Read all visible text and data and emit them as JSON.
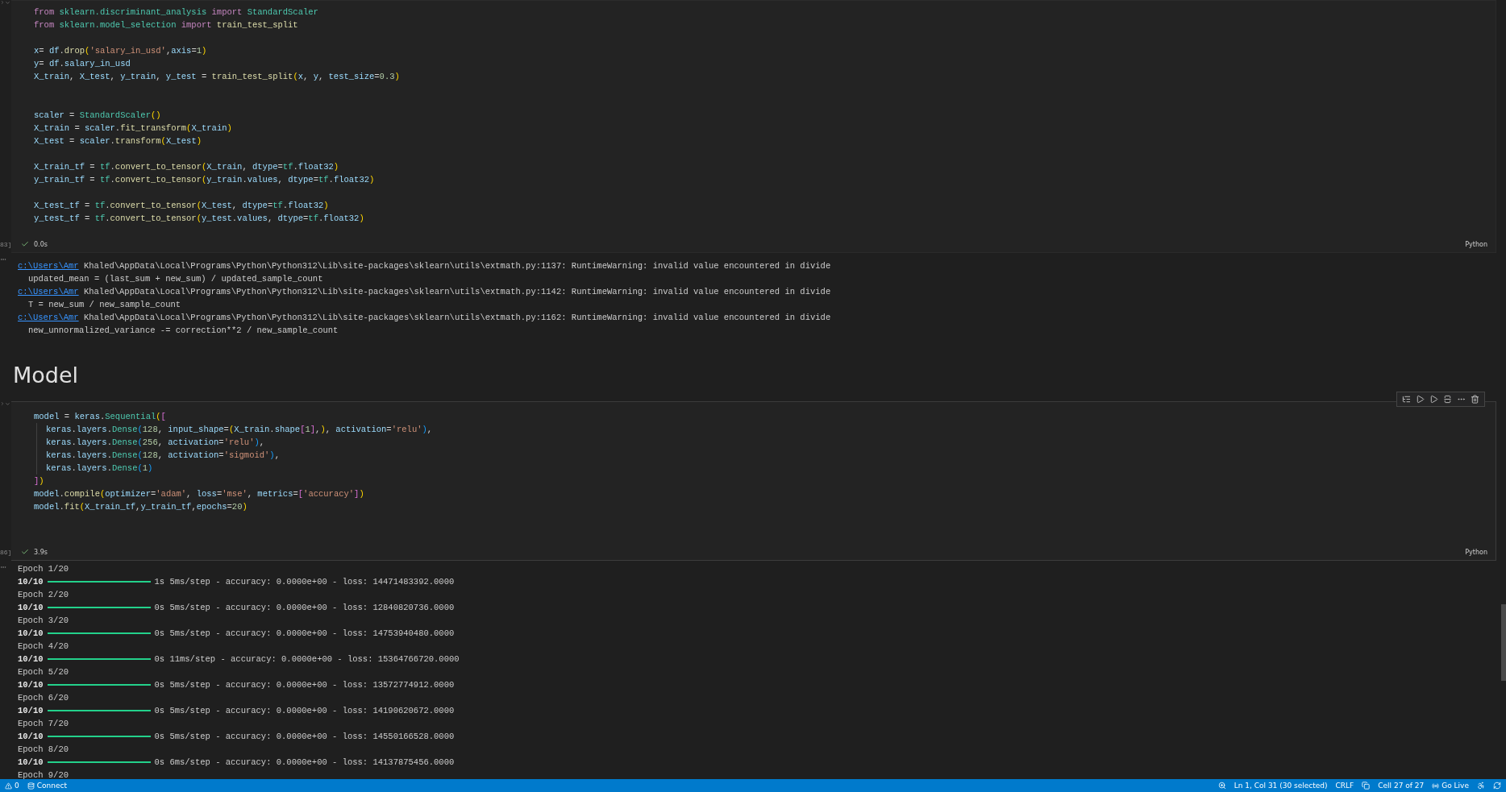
{
  "cells": [
    {
      "execution_count": "83]",
      "duration": "0.0s",
      "language": "Python",
      "focused": false,
      "lines": [
        {
          "kind": "code",
          "tokens": [
            {
              "text": "from ",
              "kind": "keyword"
            },
            {
              "text": "sklearn.discriminant_analysis ",
              "kind": "type"
            },
            {
              "text": "import ",
              "kind": "keyword"
            },
            {
              "text": "StandardScaler",
              "kind": "type"
            }
          ]
        },
        {
          "kind": "code",
          "tokens": [
            {
              "text": "from ",
              "kind": "keyword"
            },
            {
              "text": "sklearn.model_selection ",
              "kind": "type"
            },
            {
              "text": "import ",
              "kind": "keyword"
            },
            {
              "text": "train_test_split",
              "kind": "func"
            }
          ]
        },
        {
          "kind": "blank"
        },
        {
          "kind": "code",
          "tokens": [
            {
              "text": "x",
              "kind": "var"
            },
            {
              "text": "= ",
              "kind": "punct"
            },
            {
              "text": "df",
              "kind": "var"
            },
            {
              "text": ".",
              "kind": "punct"
            },
            {
              "text": "drop",
              "kind": "func"
            },
            {
              "text": "(",
              "kind": "paren"
            },
            {
              "text": "'salary_in_usd'",
              "kind": "str"
            },
            {
              "text": ",",
              "kind": "punct"
            },
            {
              "text": "axis",
              "kind": "var"
            },
            {
              "text": "=",
              "kind": "punct"
            },
            {
              "text": "1",
              "kind": "num"
            },
            {
              "text": ")",
              "kind": "paren"
            }
          ]
        },
        {
          "kind": "code",
          "tokens": [
            {
              "text": "y",
              "kind": "var"
            },
            {
              "text": "= ",
              "kind": "punct"
            },
            {
              "text": "df",
              "kind": "var"
            },
            {
              "text": ".",
              "kind": "punct"
            },
            {
              "text": "salary_in_usd",
              "kind": "var"
            }
          ]
        },
        {
          "kind": "code",
          "tokens": [
            {
              "text": "X_train",
              "kind": "var"
            },
            {
              "text": ", ",
              "kind": "punct"
            },
            {
              "text": "X_test",
              "kind": "var"
            },
            {
              "text": ", ",
              "kind": "punct"
            },
            {
              "text": "y_train",
              "kind": "var"
            },
            {
              "text": ", ",
              "kind": "punct"
            },
            {
              "text": "y_test",
              "kind": "var"
            },
            {
              "text": " = ",
              "kind": "punct"
            },
            {
              "text": "train_test_split",
              "kind": "func"
            },
            {
              "text": "(",
              "kind": "paren"
            },
            {
              "text": "x",
              "kind": "var"
            },
            {
              "text": ", ",
              "kind": "punct"
            },
            {
              "text": "y",
              "kind": "var"
            },
            {
              "text": ", ",
              "kind": "punct"
            },
            {
              "text": "test_size",
              "kind": "var"
            },
            {
              "text": "=",
              "kind": "punct"
            },
            {
              "text": "0.3",
              "kind": "num"
            },
            {
              "text": ")",
              "kind": "paren"
            }
          ]
        },
        {
          "kind": "blank"
        },
        {
          "kind": "blank"
        },
        {
          "kind": "code",
          "tokens": [
            {
              "text": "scaler",
              "kind": "var"
            },
            {
              "text": " = ",
              "kind": "punct"
            },
            {
              "text": "StandardScaler",
              "kind": "type"
            },
            {
              "text": "()",
              "kind": "paren"
            }
          ]
        },
        {
          "kind": "code",
          "tokens": [
            {
              "text": "X_train",
              "kind": "var"
            },
            {
              "text": " = ",
              "kind": "punct"
            },
            {
              "text": "scaler",
              "kind": "var"
            },
            {
              "text": ".",
              "kind": "punct"
            },
            {
              "text": "fit_transform",
              "kind": "func"
            },
            {
              "text": "(",
              "kind": "paren"
            },
            {
              "text": "X_train",
              "kind": "var"
            },
            {
              "text": ")",
              "kind": "paren"
            }
          ]
        },
        {
          "kind": "code",
          "tokens": [
            {
              "text": "X_test",
              "kind": "var"
            },
            {
              "text": " = ",
              "kind": "punct"
            },
            {
              "text": "scaler",
              "kind": "var"
            },
            {
              "text": ".",
              "kind": "punct"
            },
            {
              "text": "transform",
              "kind": "func"
            },
            {
              "text": "(",
              "kind": "paren"
            },
            {
              "text": "X_test",
              "kind": "var"
            },
            {
              "text": ")",
              "kind": "paren"
            }
          ]
        },
        {
          "kind": "blank"
        },
        {
          "kind": "code",
          "tokens": [
            {
              "text": "X_train_tf",
              "kind": "var"
            },
            {
              "text": " = ",
              "kind": "punct"
            },
            {
              "text": "tf",
              "kind": "type"
            },
            {
              "text": ".",
              "kind": "punct"
            },
            {
              "text": "convert_to_tensor",
              "kind": "func"
            },
            {
              "text": "(",
              "kind": "paren"
            },
            {
              "text": "X_train",
              "kind": "var"
            },
            {
              "text": ", ",
              "kind": "punct"
            },
            {
              "text": "dtype",
              "kind": "var"
            },
            {
              "text": "=",
              "kind": "punct"
            },
            {
              "text": "tf",
              "kind": "type"
            },
            {
              "text": ".",
              "kind": "punct"
            },
            {
              "text": "float32",
              "kind": "var"
            },
            {
              "text": ")",
              "kind": "paren"
            }
          ]
        },
        {
          "kind": "code",
          "tokens": [
            {
              "text": "y_train_tf",
              "kind": "var"
            },
            {
              "text": " = ",
              "kind": "punct"
            },
            {
              "text": "tf",
              "kind": "type"
            },
            {
              "text": ".",
              "kind": "punct"
            },
            {
              "text": "convert_to_tensor",
              "kind": "func"
            },
            {
              "text": "(",
              "kind": "paren"
            },
            {
              "text": "y_train",
              "kind": "var"
            },
            {
              "text": ".",
              "kind": "punct"
            },
            {
              "text": "values",
              "kind": "var"
            },
            {
              "text": ", ",
              "kind": "punct"
            },
            {
              "text": "dtype",
              "kind": "var"
            },
            {
              "text": "=",
              "kind": "punct"
            },
            {
              "text": "tf",
              "kind": "type"
            },
            {
              "text": ".",
              "kind": "punct"
            },
            {
              "text": "float32",
              "kind": "var"
            },
            {
              "text": ")",
              "kind": "paren"
            }
          ]
        },
        {
          "kind": "blank"
        },
        {
          "kind": "code",
          "tokens": [
            {
              "text": "X_test_tf",
              "kind": "var"
            },
            {
              "text": " = ",
              "kind": "punct"
            },
            {
              "text": "tf",
              "kind": "type"
            },
            {
              "text": ".",
              "kind": "punct"
            },
            {
              "text": "convert_to_tensor",
              "kind": "func"
            },
            {
              "text": "(",
              "kind": "paren"
            },
            {
              "text": "X_test",
              "kind": "var"
            },
            {
              "text": ", ",
              "kind": "punct"
            },
            {
              "text": "dtype",
              "kind": "var"
            },
            {
              "text": "=",
              "kind": "punct"
            },
            {
              "text": "tf",
              "kind": "type"
            },
            {
              "text": ".",
              "kind": "punct"
            },
            {
              "text": "float32",
              "kind": "var"
            },
            {
              "text": ")",
              "kind": "paren"
            }
          ]
        },
        {
          "kind": "code",
          "tokens": [
            {
              "text": "y_test_tf",
              "kind": "var"
            },
            {
              "text": " = ",
              "kind": "punct"
            },
            {
              "text": "tf",
              "kind": "type"
            },
            {
              "text": ".",
              "kind": "punct"
            },
            {
              "text": "convert_to_tensor",
              "kind": "func"
            },
            {
              "text": "(",
              "kind": "paren"
            },
            {
              "text": "y_test",
              "kind": "var"
            },
            {
              "text": ".",
              "kind": "punct"
            },
            {
              "text": "values",
              "kind": "var"
            },
            {
              "text": ", ",
              "kind": "punct"
            },
            {
              "text": "dtype",
              "kind": "var"
            },
            {
              "text": "=",
              "kind": "punct"
            },
            {
              "text": "tf",
              "kind": "type"
            },
            {
              "text": ".",
              "kind": "punct"
            },
            {
              "text": "float32",
              "kind": "var"
            },
            {
              "text": ")",
              "kind": "paren"
            }
          ]
        }
      ],
      "output": [
        {
          "kind": "warning",
          "link": "c:\\Users\\Amr",
          "text": " Khaled\\AppData\\Local\\Programs\\Python\\Python312\\Lib\\site-packages\\sklearn\\utils\\extmath.py:1137: RuntimeWarning: invalid value encountered in divide"
        },
        {
          "kind": "source",
          "text": "updated_mean = (last_sum + new_sum) / updated_sample_count"
        },
        {
          "kind": "warning",
          "link": "c:\\Users\\Amr",
          "text": " Khaled\\AppData\\Local\\Programs\\Python\\Python312\\Lib\\site-packages\\sklearn\\utils\\extmath.py:1142: RuntimeWarning: invalid value encountered in divide"
        },
        {
          "kind": "source",
          "text": "T = new_sum / new_sample_count"
        },
        {
          "kind": "warning",
          "link": "c:\\Users\\Amr",
          "text": " Khaled\\AppData\\Local\\Programs\\Python\\Python312\\Lib\\site-packages\\sklearn\\utils\\extmath.py:1162: RuntimeWarning: invalid value encountered in divide"
        },
        {
          "kind": "source",
          "text": "new_unnormalized_variance -= correction**2 / new_sample_count"
        }
      ]
    },
    {
      "heading": "Model"
    },
    {
      "execution_count": "86]",
      "duration": "3.9s",
      "language": "Python",
      "focused": true,
      "lines": [
        {
          "kind": "code",
          "tokens": [
            {
              "text": "model",
              "kind": "var"
            },
            {
              "text": " = ",
              "kind": "punct"
            },
            {
              "text": "keras",
              "kind": "var"
            },
            {
              "text": ".",
              "kind": "punct"
            },
            {
              "text": "Sequential",
              "kind": "type"
            },
            {
              "text": "(",
              "kind": "paren"
            },
            {
              "text": "[",
              "kind": "bracket"
            }
          ]
        },
        {
          "kind": "nested",
          "tokens": [
            {
              "text": "keras",
              "kind": "var"
            },
            {
              "text": ".",
              "kind": "punct"
            },
            {
              "text": "layers",
              "kind": "var"
            },
            {
              "text": ".",
              "kind": "punct"
            },
            {
              "text": "Dense",
              "kind": "type"
            },
            {
              "text": "(",
              "kind": "brace"
            },
            {
              "text": "128",
              "kind": "num"
            },
            {
              "text": ", ",
              "kind": "punct"
            },
            {
              "text": "input_shape",
              "kind": "var"
            },
            {
              "text": "=",
              "kind": "punct"
            },
            {
              "text": "(",
              "kind": "paren"
            },
            {
              "text": "X_train",
              "kind": "var"
            },
            {
              "text": ".",
              "kind": "punct"
            },
            {
              "text": "shape",
              "kind": "var"
            },
            {
              "text": "[",
              "kind": "bracket"
            },
            {
              "text": "1",
              "kind": "num"
            },
            {
              "text": "]",
              "kind": "bracket"
            },
            {
              "text": ",",
              "kind": "punct"
            },
            {
              "text": ")",
              "kind": "paren"
            },
            {
              "text": ", ",
              "kind": "punct"
            },
            {
              "text": "activation",
              "kind": "var"
            },
            {
              "text": "=",
              "kind": "punct"
            },
            {
              "text": "'relu'",
              "kind": "str"
            },
            {
              "text": ")",
              "kind": "brace"
            },
            {
              "text": ",",
              "kind": "punct"
            }
          ]
        },
        {
          "kind": "nested",
          "tokens": [
            {
              "text": "keras",
              "kind": "var"
            },
            {
              "text": ".",
              "kind": "punct"
            },
            {
              "text": "layers",
              "kind": "var"
            },
            {
              "text": ".",
              "kind": "punct"
            },
            {
              "text": "Dense",
              "kind": "type"
            },
            {
              "text": "(",
              "kind": "brace"
            },
            {
              "text": "256",
              "kind": "num"
            },
            {
              "text": ", ",
              "kind": "punct"
            },
            {
              "text": "activation",
              "kind": "var"
            },
            {
              "text": "=",
              "kind": "punct"
            },
            {
              "text": "'relu'",
              "kind": "str"
            },
            {
              "text": ")",
              "kind": "brace"
            },
            {
              "text": ",",
              "kind": "punct"
            }
          ]
        },
        {
          "kind": "nested",
          "tokens": [
            {
              "text": "keras",
              "kind": "var"
            },
            {
              "text": ".",
              "kind": "punct"
            },
            {
              "text": "layers",
              "kind": "var"
            },
            {
              "text": ".",
              "kind": "punct"
            },
            {
              "text": "Dense",
              "kind": "type"
            },
            {
              "text": "(",
              "kind": "brace"
            },
            {
              "text": "128",
              "kind": "num"
            },
            {
              "text": ", ",
              "kind": "punct"
            },
            {
              "text": "activation",
              "kind": "var"
            },
            {
              "text": "=",
              "kind": "punct"
            },
            {
              "text": "'sigmoid'",
              "kind": "str"
            },
            {
              "text": ")",
              "kind": "brace"
            },
            {
              "text": ",",
              "kind": "punct"
            }
          ]
        },
        {
          "kind": "nested",
          "tokens": [
            {
              "text": "keras",
              "kind": "var"
            },
            {
              "text": ".",
              "kind": "punct"
            },
            {
              "text": "layers",
              "kind": "var"
            },
            {
              "text": ".",
              "kind": "punct"
            },
            {
              "text": "Dense",
              "kind": "type"
            },
            {
              "text": "(",
              "kind": "brace"
            },
            {
              "text": "1",
              "kind": "num"
            },
            {
              "text": ")",
              "kind": "brace"
            }
          ]
        },
        {
          "kind": "code",
          "tokens": [
            {
              "text": "]",
              "kind": "bracket"
            },
            {
              "text": ")",
              "kind": "paren"
            }
          ]
        },
        {
          "kind": "code",
          "tokens": [
            {
              "text": "model",
              "kind": "var"
            },
            {
              "text": ".",
              "kind": "punct"
            },
            {
              "text": "compile",
              "kind": "func"
            },
            {
              "text": "(",
              "kind": "paren"
            },
            {
              "text": "optimizer",
              "kind": "var"
            },
            {
              "text": "=",
              "kind": "punct"
            },
            {
              "text": "'adam'",
              "kind": "str"
            },
            {
              "text": ", ",
              "kind": "punct"
            },
            {
              "text": "loss",
              "kind": "var"
            },
            {
              "text": "=",
              "kind": "punct"
            },
            {
              "text": "'mse'",
              "kind": "str"
            },
            {
              "text": ", ",
              "kind": "punct"
            },
            {
              "text": "metrics",
              "kind": "var"
            },
            {
              "text": "=",
              "kind": "punct"
            },
            {
              "text": "[",
              "kind": "bracket"
            },
            {
              "text": "'accuracy'",
              "kind": "str"
            },
            {
              "text": "]",
              "kind": "bracket"
            },
            {
              "text": ")",
              "kind": "paren"
            }
          ]
        },
        {
          "kind": "code",
          "tokens": [
            {
              "text": "model",
              "kind": "var"
            },
            {
              "text": ".",
              "kind": "punct"
            },
            {
              "text": "fit",
              "kind": "func"
            },
            {
              "text": "(",
              "kind": "paren"
            },
            {
              "text": "X_train_tf",
              "kind": "var"
            },
            {
              "text": ",",
              "kind": "punct"
            },
            {
              "text": "y_train_tf",
              "kind": "var"
            },
            {
              "text": ",",
              "kind": "punct"
            },
            {
              "text": "epochs",
              "kind": "var"
            },
            {
              "text": "=",
              "kind": "punct"
            },
            {
              "text": "20",
              "kind": "num"
            },
            {
              "text": ")",
              "kind": "paren"
            }
          ]
        }
      ],
      "output": [
        {
          "kind": "source",
          "text": "Epoch 1/20"
        },
        {
          "kind": "progress",
          "steps": "10/10",
          "level": 1,
          "text": "1s 5ms/step - accuracy: 0.0000e+00 - loss: 14471483392.0000"
        },
        {
          "kind": "source",
          "text": "Epoch 2/20"
        },
        {
          "kind": "progress",
          "steps": "10/10",
          "level": 1,
          "text": "0s 5ms/step - accuracy: 0.0000e+00 - loss: 12840820736.0000"
        },
        {
          "kind": "source",
          "text": "Epoch 3/20"
        },
        {
          "kind": "progress",
          "steps": "10/10",
          "level": 1,
          "text": "0s 5ms/step - accuracy: 0.0000e+00 - loss: 14753940480.0000"
        },
        {
          "kind": "source",
          "text": "Epoch 4/20"
        },
        {
          "kind": "progress",
          "steps": "10/10",
          "level": 1,
          "text": "0s 11ms/step - accuracy: 0.0000e+00 - loss: 15364766720.0000"
        },
        {
          "kind": "source",
          "text": "Epoch 5/20"
        },
        {
          "kind": "progress",
          "steps": "10/10",
          "level": 1,
          "text": "0s 5ms/step - accuracy: 0.0000e+00 - loss: 13572774912.0000"
        },
        {
          "kind": "source",
          "text": "Epoch 6/20"
        },
        {
          "kind": "progress",
          "steps": "10/10",
          "level": 1,
          "text": "0s 5ms/step - accuracy: 0.0000e+00 - loss: 14190620672.0000"
        },
        {
          "kind": "source",
          "text": "Epoch 7/20"
        },
        {
          "kind": "progress",
          "steps": "10/10",
          "level": 1,
          "text": "0s 5ms/step - accuracy: 0.0000e+00 - loss: 14550166528.0000"
        },
        {
          "kind": "source",
          "text": "Epoch 8/20"
        },
        {
          "kind": "progress",
          "steps": "10/10",
          "level": 1,
          "text": "0s 6ms/step - accuracy: 0.0000e+00 - loss: 14137875456.0000"
        },
        {
          "kind": "source",
          "text": "Epoch 9/20"
        }
      ]
    }
  ],
  "status_bar": {
    "problems": "0",
    "connect": "Connect",
    "position": "Ln 1, Col 31 (30 selected)",
    "eol": "CRLF",
    "cell": "Cell 27 of 27",
    "go_live": "Go Live"
  }
}
